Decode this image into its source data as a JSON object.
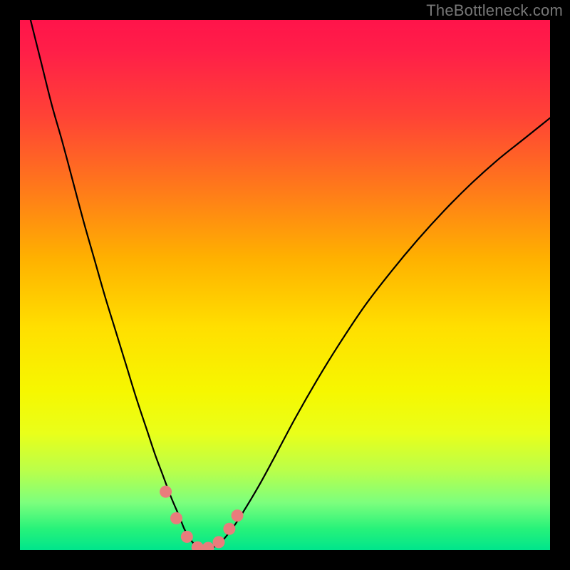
{
  "watermark": "TheBottleneck.com",
  "colors": {
    "background": "#000000",
    "gradient_top": "#ff144a",
    "gradient_bottom": "#00e58c",
    "curve": "#000000",
    "marker_fill": "#e97c7c",
    "marker_stroke": "#a84a4a"
  },
  "chart_data": {
    "type": "line",
    "title": "",
    "xlabel": "",
    "ylabel": "",
    "xlim": [
      0,
      100
    ],
    "ylim": [
      0,
      100
    ],
    "x": [
      0,
      2,
      4,
      6,
      8,
      10,
      12,
      14,
      16,
      18,
      20,
      22,
      24,
      25.5,
      27,
      28.5,
      30,
      31,
      32,
      33,
      34,
      36,
      38,
      40,
      42,
      45,
      48,
      52,
      56,
      60,
      65,
      70,
      75,
      80,
      85,
      90,
      95,
      100
    ],
    "values": [
      108,
      100,
      92,
      84,
      77,
      69.5,
      62,
      55,
      48,
      41.5,
      35,
      28.5,
      22.5,
      18,
      14,
      10,
      6.5,
      4,
      2.2,
      1.0,
      0.3,
      0.3,
      1.6,
      4.0,
      7.0,
      12.0,
      17.5,
      25.0,
      32.0,
      38.5,
      46.0,
      52.5,
      58.5,
      64.0,
      69.0,
      73.5,
      77.5,
      81.5
    ],
    "markers": {
      "x": [
        27.5,
        29.5,
        31.5,
        33.5,
        35.5,
        37.5,
        39.5,
        41.0
      ],
      "values": [
        11.0,
        6.0,
        2.5,
        0.5,
        0.4,
        1.5,
        4.0,
        6.5
      ]
    },
    "legend": null,
    "grid": false
  }
}
